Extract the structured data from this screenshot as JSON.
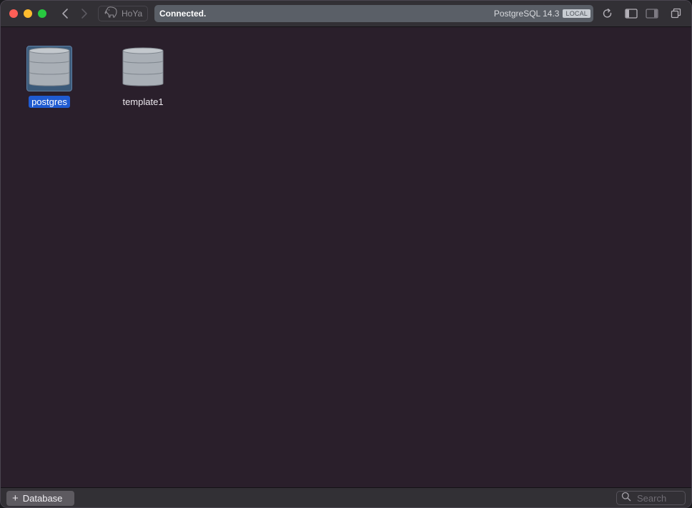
{
  "titlebar": {
    "connection_name": "HoYa",
    "status": "Connected.",
    "server_version": "PostgreSQL 14.3",
    "server_badge": "LOCAL"
  },
  "databases": [
    {
      "name": "postgres",
      "selected": true
    },
    {
      "name": "template1",
      "selected": false
    }
  ],
  "bottombar": {
    "add_database_label": "Database",
    "search_placeholder": "Search"
  },
  "icons": {
    "close": "close-traffic-light",
    "minimize": "minimize-traffic-light",
    "zoom": "zoom-traffic-light",
    "back": "chevron-left-icon",
    "forward": "chevron-right-icon",
    "connection": "elephant-icon",
    "refresh": "refresh-icon",
    "left_sidebar": "left-sidebar-icon",
    "right_sidebar": "right-sidebar-icon",
    "windows": "windows-icon",
    "database": "database-icon",
    "search": "search-icon",
    "add": "plus-icon"
  },
  "colors": {
    "background": "#2a1f2b",
    "selection": "#1f5bd1",
    "status_bar": "#5a5f67"
  }
}
